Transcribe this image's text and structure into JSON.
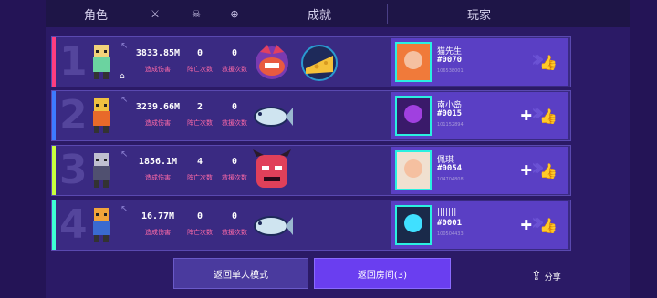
{
  "header": {
    "col_role": "角色",
    "col_achievement": "成就",
    "col_player": "玩家",
    "icons": [
      "sword-icon",
      "skull-icon",
      "plus-circle-icon"
    ]
  },
  "rows": [
    {
      "rank": "1",
      "stripe": "#ff3d7f",
      "damage": "3833.85M",
      "deaths": "0",
      "rescues": "0",
      "damage_label": "造成伤害",
      "deaths_label": "阵亡次数",
      "rescues_label": "救援次数",
      "player": {
        "name": "猫先生",
        "id": "#0070",
        "uid": "106538001"
      },
      "host": true,
      "add_friend": false
    },
    {
      "rank": "2",
      "stripe": "#3d7bff",
      "damage": "3239.66M",
      "deaths": "2",
      "rescues": "0",
      "damage_label": "造成伤害",
      "deaths_label": "阵亡次数",
      "rescues_label": "救援次数",
      "player": {
        "name": "南小岛",
        "id": "#0015",
        "uid": "101152894"
      },
      "host": false,
      "add_friend": true
    },
    {
      "rank": "3",
      "stripe": "#c8ff3d",
      "damage": "1856.1M",
      "deaths": "4",
      "rescues": "0",
      "damage_label": "造成伤害",
      "deaths_label": "阵亡次数",
      "rescues_label": "救援次数",
      "player": {
        "name": "佩琪",
        "id": "#0054",
        "uid": "104704808"
      },
      "host": false,
      "add_friend": true
    },
    {
      "rank": "4",
      "stripe": "#3dffd4",
      "damage": "16.77M",
      "deaths": "0",
      "rescues": "0",
      "damage_label": "造成伤害",
      "deaths_label": "阵亡次数",
      "rescues_label": "救援次数",
      "player": {
        "name": "|||||||",
        "id": "#0001",
        "uid": "100504433"
      },
      "host": false,
      "add_friend": true
    }
  ],
  "buttons": {
    "single_mode": "返回单人模式",
    "back_room": "返回房间(3)",
    "share": "分享"
  }
}
